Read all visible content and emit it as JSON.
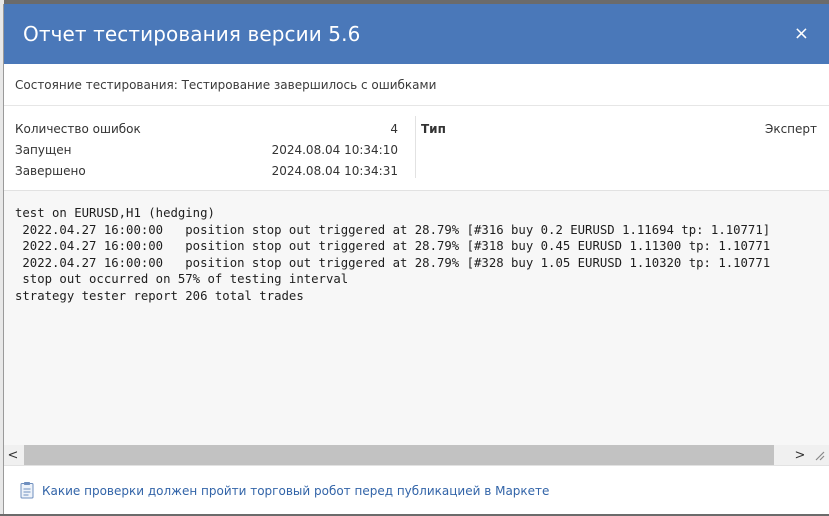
{
  "dialog": {
    "title": "Отчет тестирования версии 5.6",
    "close_label": "×"
  },
  "status": {
    "text": "Состояние тестирования: Тестирование завершилось с ошибками"
  },
  "info": {
    "left": [
      {
        "label": "Количество ошибок",
        "value": "4"
      },
      {
        "label": "Запущен",
        "value": "2024.08.04 10:34:10"
      },
      {
        "label": "Завершено",
        "value": "2024.08.04 10:34:31"
      }
    ],
    "right": {
      "label": "Тип",
      "value": "Эксперт"
    }
  },
  "log": {
    "lines": [
      "test on EURUSD,H1 (hedging)",
      " 2022.04.27 16:00:00   position stop out triggered at 28.79% [#316 buy 0.2 EURUSD 1.11694 tp: 1.10771]",
      " 2022.04.27 16:00:00   position stop out triggered at 28.79% [#318 buy 0.45 EURUSD 1.11300 tp: 1.10771",
      " 2022.04.27 16:00:00   position stop out triggered at 28.79% [#328 buy 1.05 EURUSD 1.10320 tp: 1.10771",
      " stop out occurred on 57% of testing interval",
      "strategy tester report 206 total trades"
    ]
  },
  "scrollbar": {
    "left_arrow": "<",
    "right_arrow": ">"
  },
  "footer": {
    "icon": "clipboard-icon",
    "link_text": "Какие проверки должен пройти торговый робот перед публикацией в Маркете"
  },
  "colors": {
    "titlebar": "#4a78b9",
    "link": "#3264a8"
  }
}
